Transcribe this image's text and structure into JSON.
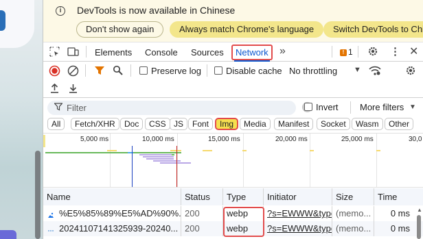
{
  "banner": {
    "message": "DevTools is now available in Chinese",
    "dont_show": "Don't show again",
    "always_match": "Always match Chrome's language",
    "switch": "Switch DevTools to Chin"
  },
  "tabs": {
    "elements": "Elements",
    "console": "Console",
    "sources": "Sources",
    "network": "Network",
    "more": "»",
    "issues_count": "1"
  },
  "toolbar": {
    "preserve_log": "Preserve log",
    "disable_cache": "Disable cache",
    "throttling": "No throttling"
  },
  "filter": {
    "placeholder": "Filter",
    "invert": "Invert",
    "more_filters": "More filters"
  },
  "type_filters": [
    "All",
    "Fetch/XHR",
    "Doc",
    "CSS",
    "JS",
    "Font",
    "Img",
    "Media",
    "Manifest",
    "Socket",
    "Wasm",
    "Other"
  ],
  "active_type": "Img",
  "timeline": {
    "ticks": [
      "5,000 ms",
      "10,000 ms",
      "15,000 ms",
      "20,000 ms",
      "25,000 ms",
      "30,0"
    ]
  },
  "table": {
    "columns": [
      "Name",
      "Status",
      "Type",
      "Initiator",
      "Size",
      "Time"
    ],
    "rows": [
      {
        "name": "%E5%85%89%E5%AD%90%...",
        "status": "200",
        "type": "webp",
        "initiator": "?s=EWWW&type",
        "size": "(memo...",
        "time": "0 ms"
      },
      {
        "name": "20241107141325939-20240...",
        "status": "200",
        "type": "webp",
        "initiator": "?s=EWWW&type",
        "size": "(memo...",
        "time": "0 ms"
      }
    ]
  },
  "colors": {
    "accent": "#0b57d0",
    "highlight_border": "#e24b4b",
    "banner_bg": "#fdf9e6",
    "banner_button": "#f3e68b",
    "record_red": "#d93025",
    "filter_orange": "#e37400"
  },
  "icons": [
    "inspect-icon",
    "device-toolbar-icon",
    "issues-flag-icon",
    "settings-gear-icon",
    "kebab-menu-icon",
    "close-icon",
    "record-stop-icon",
    "clear-icon",
    "filter-funnel-icon",
    "search-icon",
    "wifi-conditions-icon",
    "upload-icon",
    "download-icon",
    "info-icon"
  ]
}
